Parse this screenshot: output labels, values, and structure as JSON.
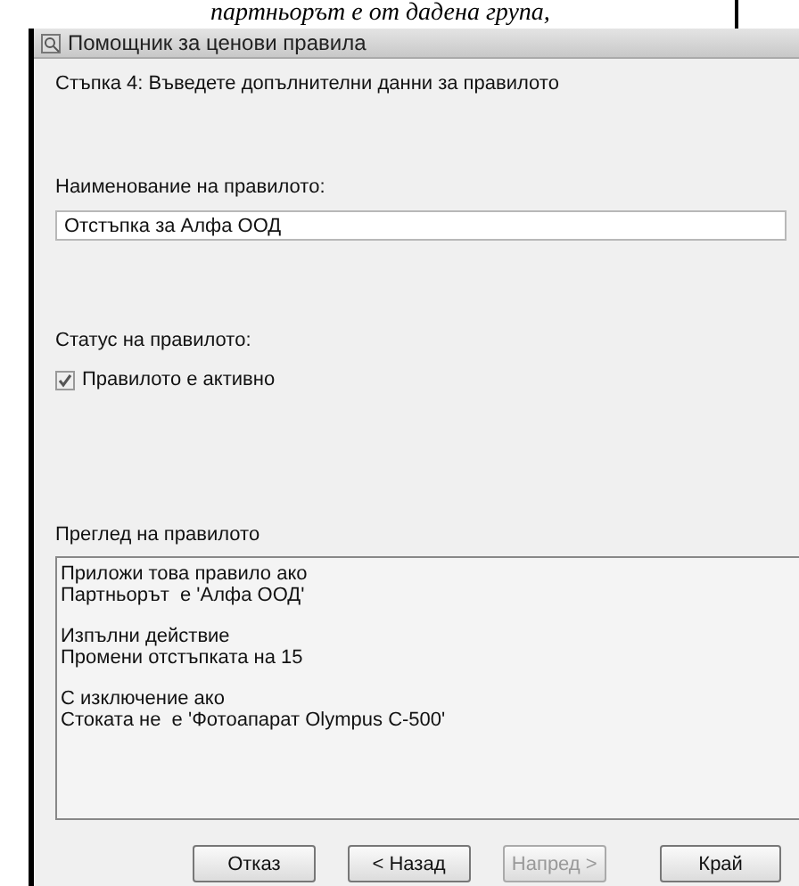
{
  "document_text": "партньорът е от дадена група,",
  "window": {
    "title": "Помощник за ценови правила"
  },
  "step": "Стъпка 4: Въведете допълнителни данни за правилото",
  "name_label": "Наименование на правилото:",
  "name_field": {
    "value": "Отстъпка за Алфа ООД"
  },
  "status_label": "Статус на правилото:",
  "active_checkbox": {
    "label": "Правилото е активно",
    "checked": true
  },
  "preview_label": "Преглед на правилото",
  "preview": [
    [
      "Приложи това правило ако",
      "Партньорът  е 'Алфа ООД'"
    ],
    [
      "Изпълни действие",
      "Промени отстъпката на 15"
    ],
    [
      "С изключение ако",
      "Стоката не  е 'Фотоапарат Olympus C-500'"
    ]
  ],
  "buttons": [
    {
      "label": "Отказ",
      "disabled": false
    },
    {
      "label": "< Назад",
      "disabled": false
    },
    {
      "label": "Напред >",
      "disabled": true
    },
    {
      "label": "Край",
      "disabled": false
    }
  ]
}
